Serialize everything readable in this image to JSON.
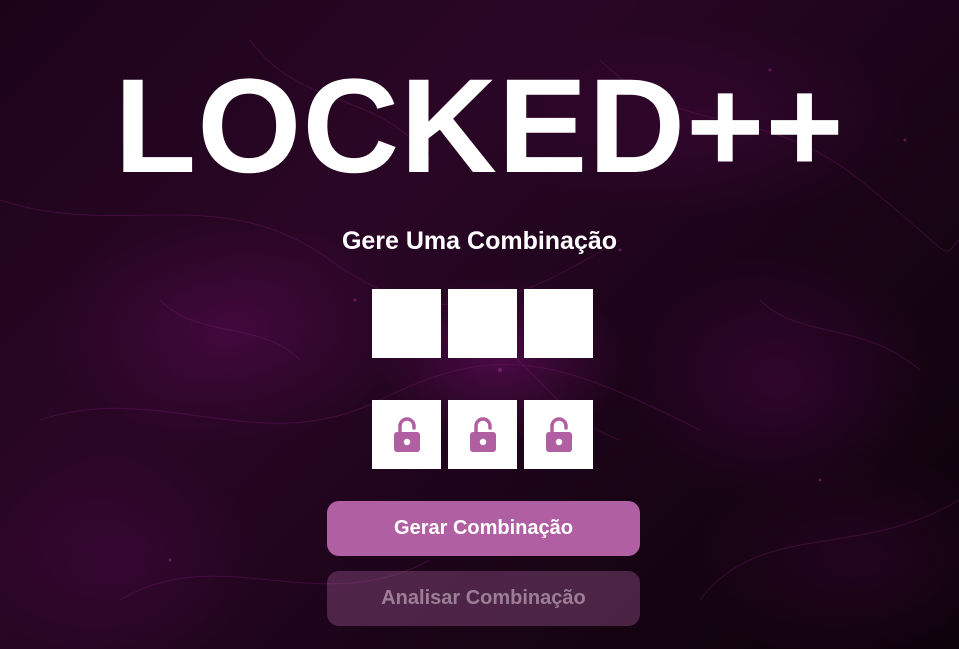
{
  "app": {
    "title": "LOCKED++",
    "subtitle": "Gere Uma Combinação"
  },
  "combination": {
    "digits": [
      "",
      "",
      ""
    ],
    "locks": [
      {
        "icon": "unlocked-padlock-icon",
        "state": "unlocked"
      },
      {
        "icon": "unlocked-padlock-icon",
        "state": "unlocked"
      },
      {
        "icon": "unlocked-padlock-icon",
        "state": "unlocked"
      }
    ]
  },
  "actions": {
    "generate_label": "Gerar Combinação",
    "analyze_label": "Analisar Combinação",
    "analyze_enabled": false
  },
  "theme": {
    "accent": "#b060a2",
    "background": "#1c0418",
    "box": "#ffffff",
    "text": "#ffffff"
  }
}
